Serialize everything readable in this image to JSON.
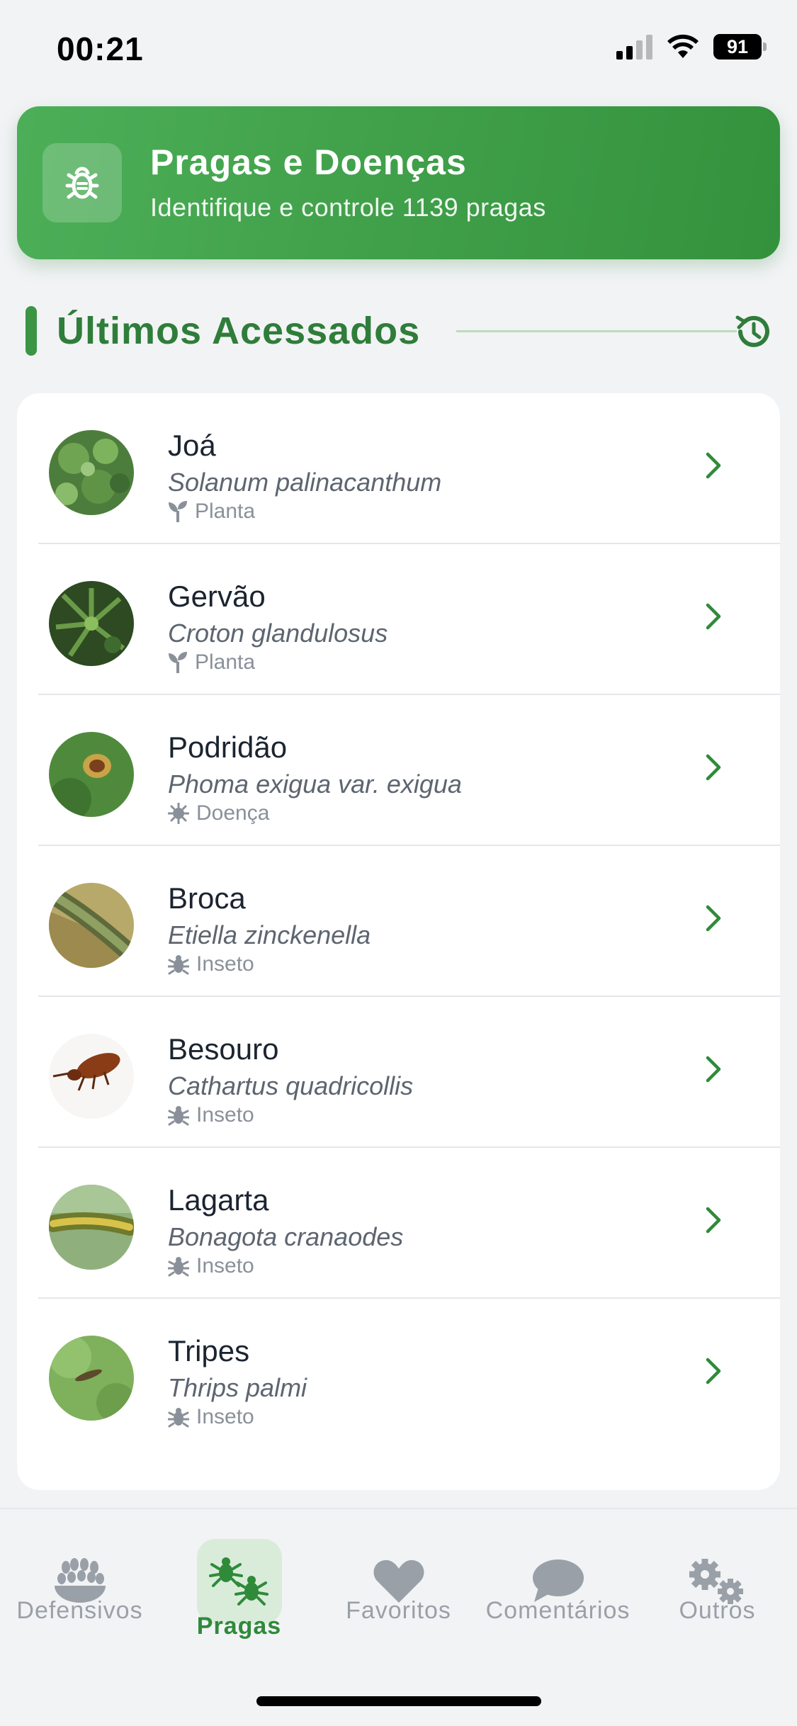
{
  "status_bar": {
    "time": "00:21",
    "battery": "91"
  },
  "header": {
    "title": "Pragas e Doenças",
    "subtitle": "Identifique e controle 1139 pragas",
    "icon": "bug-icon",
    "gradient_colors": [
      "#4caf58",
      "#34923d"
    ]
  },
  "section": {
    "title": "Últimos Acessados",
    "icon": "history-icon",
    "accent_color": "#3b9544"
  },
  "items": [
    {
      "name": "Joá",
      "scientific": "Solanum palinacanthum",
      "type": "Planta",
      "type_icon": "sprout-icon"
    },
    {
      "name": "Gervão",
      "scientific": "Croton glandulosus",
      "type": "Planta",
      "type_icon": "sprout-icon"
    },
    {
      "name": "Podridão",
      "scientific": "Phoma exigua var. exigua",
      "type": "Doença",
      "type_icon": "virus-icon"
    },
    {
      "name": "Broca",
      "scientific": "Etiella zinckenella",
      "type": "Inseto",
      "type_icon": "bug-icon"
    },
    {
      "name": "Besouro",
      "scientific": "Cathartus quadricollis",
      "type": "Inseto",
      "type_icon": "bug-icon"
    },
    {
      "name": "Lagarta",
      "scientific": "Bonagota cranaodes",
      "type": "Inseto",
      "type_icon": "bug-icon"
    },
    {
      "name": "Tripes",
      "scientific": "Thrips palmi",
      "type": "Inseto",
      "type_icon": "bug-icon"
    }
  ],
  "nav": {
    "items": [
      {
        "label": "Defensivos",
        "icon": "wheat-bowl-icon",
        "active": false
      },
      {
        "label": "Pragas",
        "icon": "bugs-icon",
        "active": true
      },
      {
        "label": "Favoritos",
        "icon": "heart-icon",
        "active": false
      },
      {
        "label": "Comentários",
        "icon": "comment-icon",
        "active": false
      },
      {
        "label": "Outros",
        "icon": "gears-icon",
        "active": false
      }
    ],
    "active_color": "#2f8a3a",
    "inactive_color": "#9aa0a8"
  }
}
